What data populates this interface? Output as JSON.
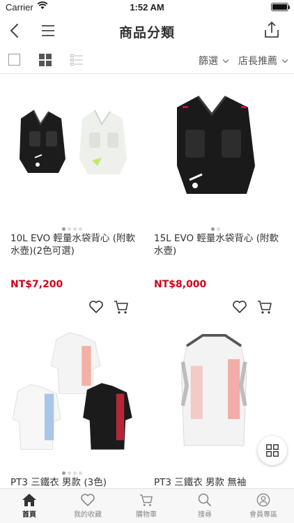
{
  "status_bar": {
    "carrier": "Carrier",
    "time": "1:52 AM"
  },
  "header": {
    "title": "商品分類"
  },
  "toolbar": {
    "filter_label": "篩選",
    "sort_label": "店長推薦"
  },
  "products": [
    {
      "name": "10L EVO 輕量水袋背心 (附軟水壺)(2色可選)",
      "price": "NT$7,200",
      "dots_total": 4,
      "dots_active": 1
    },
    {
      "name": "15L EVO 輕量水袋背心 (附軟水壺)",
      "price": "NT$8,000",
      "dots_total": 2,
      "dots_active": 1
    },
    {
      "name": "PT3 三鐵衣 男款 (3色)",
      "price": "",
      "dots_total": 4,
      "dots_active": 1
    },
    {
      "name": "PT3 三鐵衣 男款 無袖",
      "price": "",
      "dots_total": 0,
      "dots_active": 0
    }
  ],
  "tabbar": {
    "items": [
      {
        "label": "首頁",
        "icon": "home-icon",
        "active": true
      },
      {
        "label": "我的收藏",
        "icon": "heart-icon",
        "active": false
      },
      {
        "label": "購物車",
        "icon": "cart-icon",
        "active": false
      },
      {
        "label": "搜尋",
        "icon": "search-icon",
        "active": false
      },
      {
        "label": "會員專區",
        "icon": "user-icon",
        "active": false
      }
    ]
  },
  "colors": {
    "price": "#d0021b",
    "accent": "#e8e8e8"
  }
}
